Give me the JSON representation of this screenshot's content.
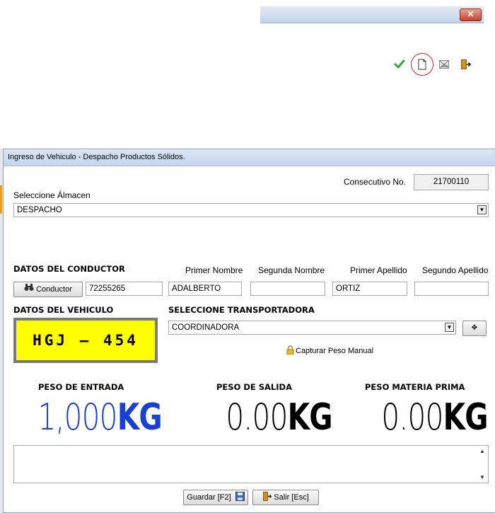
{
  "background_window": {
    "close_label": "✕"
  },
  "toolbar": {
    "icons": [
      "check-icon",
      "new-document-icon",
      "image-icon",
      "exit-icon"
    ],
    "accent": "#c62828"
  },
  "dialog": {
    "title": "Ingreso de Vehiculo - Despacho Productos Sólidos.",
    "consecutive_label": "Consecutivo No.",
    "consecutive_value": "21700110",
    "warehouse_label": "Seleccione Álmacen",
    "warehouse_value": "DESPACHO",
    "driver": {
      "section_label": "DATOS DEL CONDUCTOR",
      "button_label": "Conductor",
      "id_value": "72255265",
      "first_name_label": "Primer Nombre",
      "first_name_value": "ADALBERTO",
      "second_name_label": "Segunda Nombre",
      "second_name_value": "",
      "first_surname_label": "Primer Apellido",
      "first_surname_value": "ORTIZ",
      "second_surname_label": "Segundo Apellido",
      "second_surname_value": ""
    },
    "vehicle": {
      "section_label": "DATOS DEL VEHICULO",
      "plate": "HGJ – 454"
    },
    "transport": {
      "section_label": "SELECCIONE TRANSPORTADORA",
      "value": "COORDINADORA",
      "add_label": "✥",
      "manual_weight_label": "Capturar Peso Manual"
    },
    "weights": {
      "entry_label": "PESO DE ENTRADA",
      "entry_value": "1,000",
      "exit_label": "PESO DE SALIDA",
      "exit_value": "0.00",
      "raw_label": "PESO MATERIA PRIMA",
      "raw_value": "0.00",
      "unit": "KG",
      "entry_color": "#1a3fd6",
      "default_color": "#000000"
    },
    "buttons": {
      "save_label": "Guardar [F2]",
      "exit_label": "Salir [Esc]"
    }
  }
}
